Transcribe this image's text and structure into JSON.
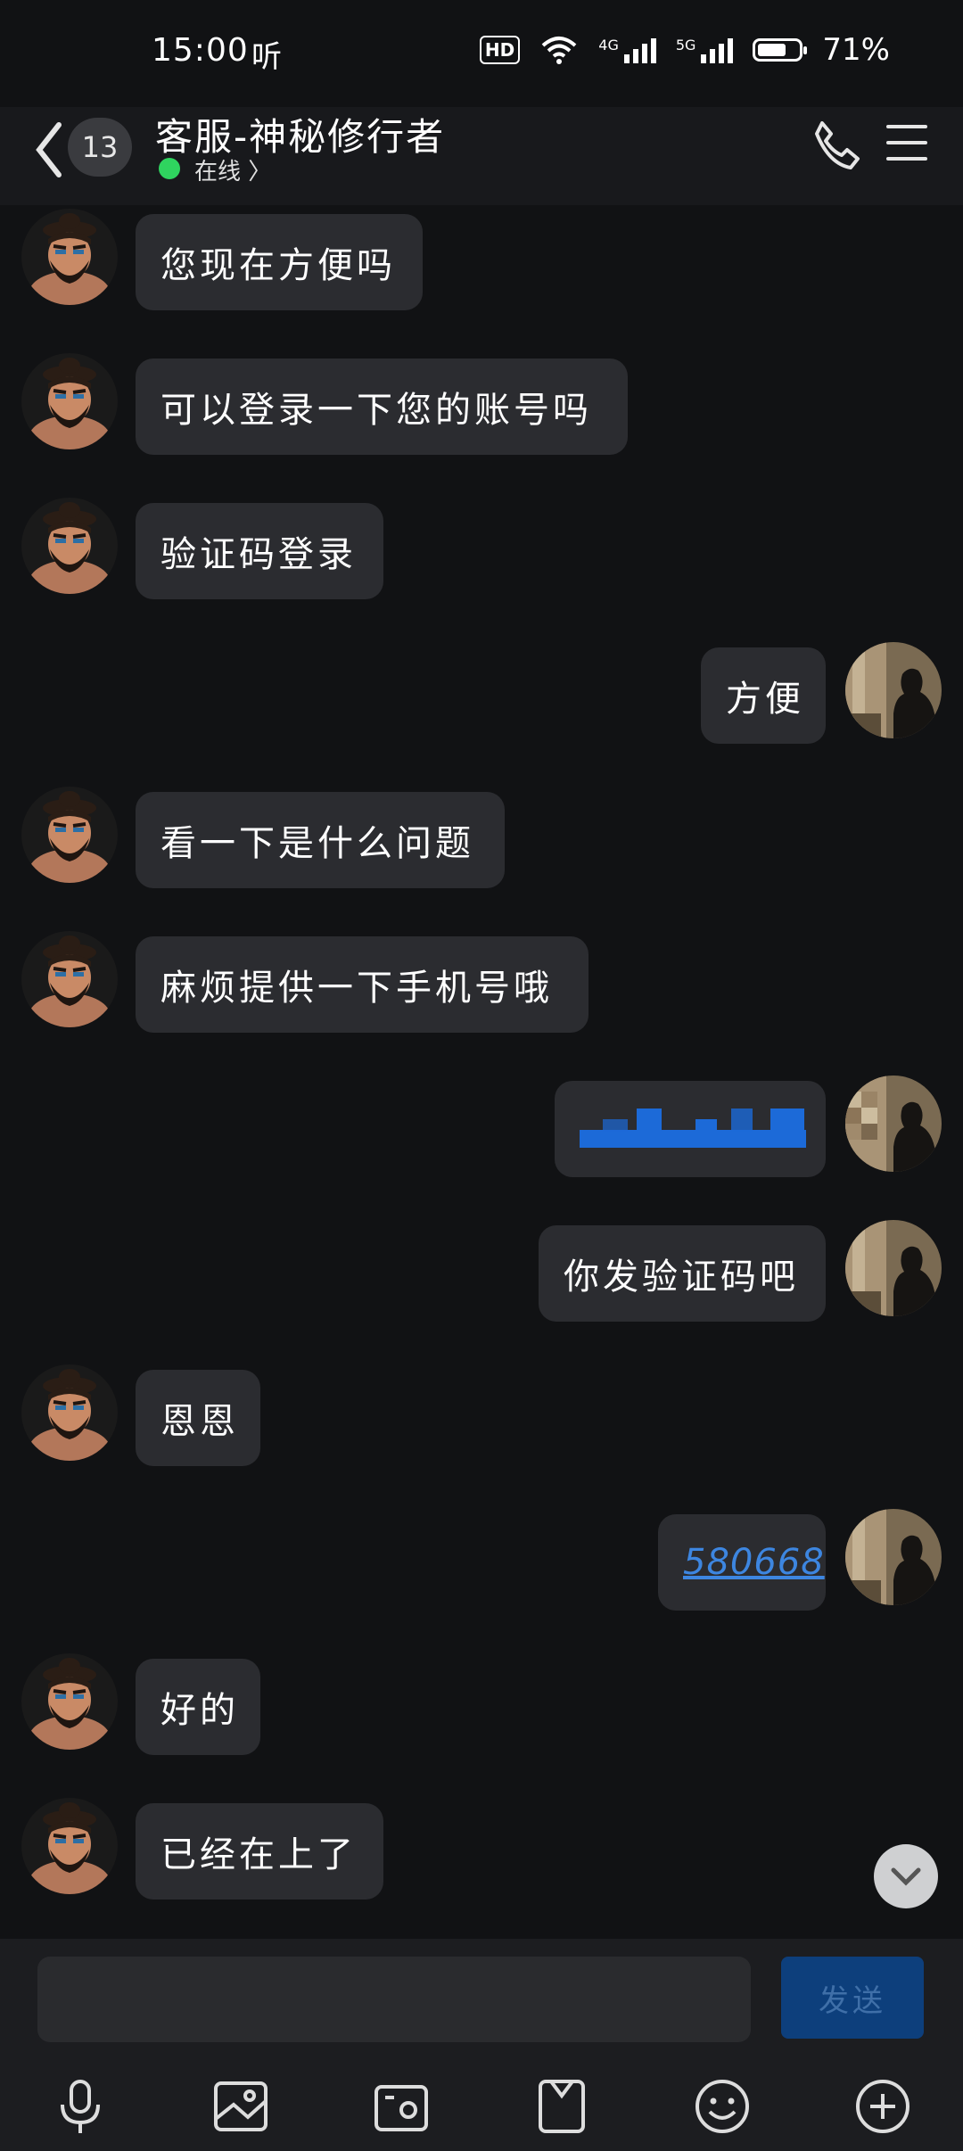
{
  "status": {
    "time": "15:00",
    "hear_icon": "听",
    "hd": "HD",
    "sig1": "4G",
    "sig2": "5G",
    "battery": "71%",
    "battery_level": 0.71
  },
  "header": {
    "unread": "13",
    "title": "客服-神秘修行者",
    "online": "在线 〉"
  },
  "messages": [
    {
      "side": "left",
      "text": "您现在方便吗"
    },
    {
      "side": "left",
      "text": "可以登录一下您的账号吗"
    },
    {
      "side": "left",
      "text": "验证码登录"
    },
    {
      "side": "right",
      "text": "方便"
    },
    {
      "side": "left",
      "text": "看一下是什么问题"
    },
    {
      "side": "left",
      "text": "麻烦提供一下手机号哦"
    },
    {
      "side": "right",
      "text": ""
    },
    {
      "side": "right",
      "text": "你发验证码吧"
    },
    {
      "side": "left",
      "text": "恩恩"
    },
    {
      "side": "right",
      "text": "580668"
    },
    {
      "side": "left",
      "text": "好的"
    },
    {
      "side": "left",
      "text": "已经在上了"
    }
  ],
  "input": {
    "placeholder": "",
    "send_label": "发送"
  },
  "toolbar": [
    "microphone-icon",
    "image-icon",
    "camera-icon",
    "file-icon",
    "emoji-icon",
    "plus-icon"
  ],
  "colors": {
    "background": "#111214",
    "bubble": "#2b2c30",
    "link": "#3d86e0",
    "online": "#2fd45f",
    "send": "#0d3f7c"
  }
}
